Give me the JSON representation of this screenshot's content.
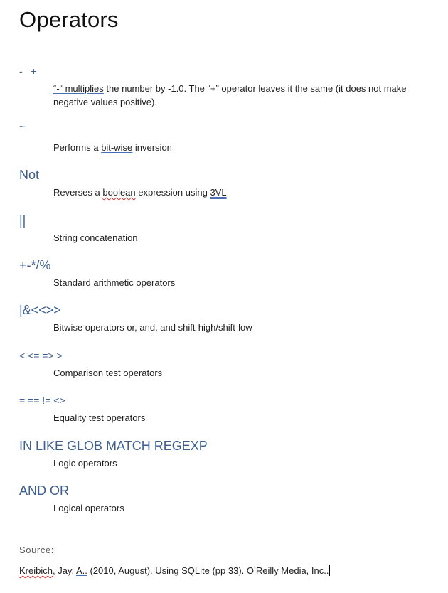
{
  "title": "Operators",
  "operators": [
    {
      "symbol": "-   +",
      "segments": [
        {
          "text": "“-“ multiplies",
          "style": "blue-dbl"
        },
        {
          "text": " the number by -1.0. The “+” operator leaves it the same (it does not make negative values positive).",
          "style": ""
        }
      ]
    },
    {
      "symbol": "~",
      "segments": [
        {
          "text": "Performs a ",
          "style": ""
        },
        {
          "text": "bit-wise",
          "style": "blue-dbl"
        },
        {
          "text": " inversion",
          "style": ""
        }
      ]
    },
    {
      "symbol": "Not",
      "segments": [
        {
          "text": "Reverses a ",
          "style": ""
        },
        {
          "text": "boolean",
          "style": "red-wavy"
        },
        {
          "text": " expression using ",
          "style": ""
        },
        {
          "text": "3VL",
          "style": "blue-dbl"
        }
      ]
    },
    {
      "symbol": "||",
      "segments": [
        {
          "text": "String concatenation",
          "style": ""
        }
      ]
    },
    {
      "symbol": "+-*/%",
      "segments": [
        {
          "text": "Standard arithmetic operators",
          "style": ""
        }
      ]
    },
    {
      "symbol": "|&<<>>",
      "segments": [
        {
          "text": "Bitwise operators or, and, and shift-high/shift-low",
          "style": ""
        }
      ]
    },
    {
      "symbol": "< <= => >",
      "segments": [
        {
          "text": "Comparison test operators",
          "style": ""
        }
      ]
    },
    {
      "symbol": "= == != <>",
      "segments": [
        {
          "text": "Equality test operators",
          "style": ""
        }
      ]
    },
    {
      "symbol": "IN LIKE GLOB MATCH REGEXP",
      "segments": [
        {
          "text": "Logic operators",
          "style": ""
        }
      ]
    },
    {
      "symbol": "AND OR",
      "segments": [
        {
          "text": "Logical operators",
          "style": ""
        }
      ]
    }
  ],
  "source": {
    "label": "Source:",
    "segments": [
      {
        "text": "Kreibich",
        "style": "red-wavy"
      },
      {
        "text": ", Jay, ",
        "style": ""
      },
      {
        "text": "A..",
        "style": "blue-dbl"
      },
      {
        "text": " (2010, August). Using SQLite (pp 33). O’Reilly Media, Inc..",
        "style": ""
      }
    ]
  },
  "colors": {
    "heading_accent": "#3d5f8f",
    "grammar_underline": "#4a6fb5",
    "spelling_underline": "#d23030"
  }
}
